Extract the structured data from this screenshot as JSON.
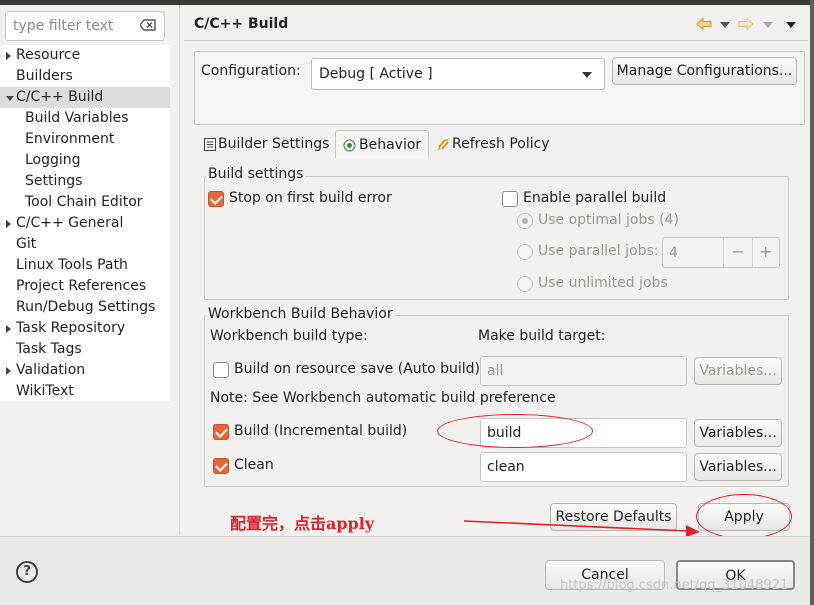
{
  "filter": {
    "placeholder": "type filter text"
  },
  "tree": [
    {
      "label": "Resource",
      "expander": "closed"
    },
    {
      "label": "Builders",
      "expander": "none"
    },
    {
      "label": "C/C++ Build",
      "expander": "open",
      "selected": true
    },
    {
      "label": "Build Variables",
      "expander": "child"
    },
    {
      "label": "Environment",
      "expander": "child"
    },
    {
      "label": "Logging",
      "expander": "child"
    },
    {
      "label": "Settings",
      "expander": "child"
    },
    {
      "label": "Tool Chain Editor",
      "expander": "child"
    },
    {
      "label": "C/C++ General",
      "expander": "closed"
    },
    {
      "label": "Git",
      "expander": "none"
    },
    {
      "label": "Linux Tools Path",
      "expander": "none"
    },
    {
      "label": "Project References",
      "expander": "none"
    },
    {
      "label": "Run/Debug Settings",
      "expander": "none"
    },
    {
      "label": "Task Repository",
      "expander": "closed"
    },
    {
      "label": "Task Tags",
      "expander": "none"
    },
    {
      "label": "Validation",
      "expander": "closed"
    },
    {
      "label": "WikiText",
      "expander": "none"
    }
  ],
  "page": {
    "title": "C/C++ Build"
  },
  "config": {
    "label": "Configuration:",
    "value": "Debug  [ Active ]",
    "manage_label": "Manage Configurations..."
  },
  "tabs": [
    "Builder Settings",
    "Behavior",
    "Refresh Policy"
  ],
  "build_settings": {
    "legend": "Build settings",
    "stop_on_error": "Stop on first build error",
    "enable_parallel": "Enable parallel build",
    "optimal_jobs": "Use optimal jobs (4)",
    "parallel_jobs": "Use parallel jobs:",
    "parallel_jobs_value": "4",
    "minus": "−",
    "plus": "+",
    "unlimited_jobs": "Use unlimited jobs"
  },
  "workbench": {
    "legend": "Workbench Build Behavior",
    "build_type_label": "Workbench build type:",
    "make_target_label": "Make build target:",
    "auto_build": "Build on resource save (Auto build)",
    "auto_build_target": "all",
    "variables": "Variables...",
    "note": "Note: See Workbench automatic build preference",
    "incremental": "Build (Incremental build)",
    "incremental_target": "build",
    "clean": "Clean",
    "clean_target": "clean"
  },
  "buttons": {
    "restore_defaults": "Restore Defaults",
    "apply": "Apply",
    "cancel": "Cancel",
    "ok": "OK",
    "help": "?"
  },
  "annotation": {
    "text": "配置完，点击apply"
  },
  "watermark": "https://blog.csdn.net/qq_31048921",
  "colors": {
    "checkbox_accent": "#e2673a",
    "annotation_red": "#e0202a"
  }
}
